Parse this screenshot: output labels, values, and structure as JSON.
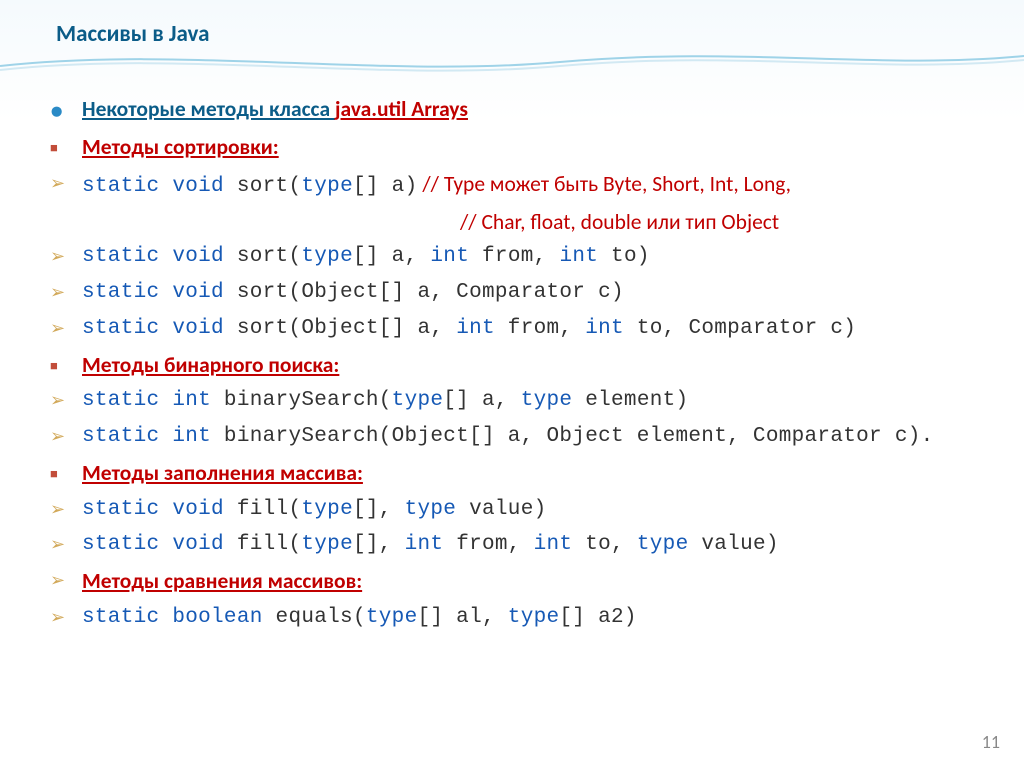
{
  "title": "Массивы в Java",
  "heading_main_prefix": "Некоторые методы класса ",
  "heading_main_red": "java.util Arrays",
  "sections": {
    "sort_heading": "Методы сортировки:",
    "sort1_code": "static void sort(type[] a)",
    "sort1_comment": "  // Type может быть Byte, Short, Int, Long,",
    "sort1_comment2": "// Char, float, double или тип Object",
    "sort2": "static void sort(type[] a, int from, int to)",
    "sort3": "static void sort(Object[] a, Comparator c)",
    "sort4": "static void sort(Object[] a, int from, int to, Comparator c)",
    "bsearch_heading": "Методы бинарного поиска:",
    "bsearch1": "static int binarySearch(type[] a, type element)",
    "bsearch2": "static int binarySearch(Object[] a, Object element, Comparator c).",
    "fill_heading": " Методы заполнения массива:",
    "fill1": "static void fill(type[], type value)",
    "fill2": "static void fill(type[], int from, int to, type value)",
    "cmp_heading": " Методы сравнения массивов:",
    "cmp1": "static boolean equals(type[] al, type[] a2)"
  },
  "page_number": "11"
}
